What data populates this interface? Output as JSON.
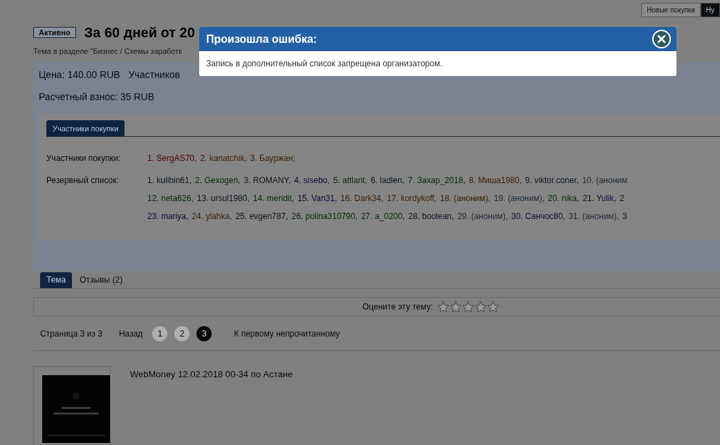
{
  "top_buttons": [
    {
      "label": "Новые покупки",
      "selected": false
    },
    {
      "label": "Ну",
      "selected": true
    }
  ],
  "thread": {
    "status": "Активно",
    "title": "За 60 дней от 20",
    "subtitle": "Тема в разделе \"Бизнес / Схемы заработк"
  },
  "purchase": {
    "price": "Цена: 140.00 RUB",
    "participants_count": "Участников",
    "fee": "Расчетный взнос: 35 RUB",
    "tab": {
      "label": "Участники покупки",
      "selected": true
    },
    "participants_label": "Участники покупки:",
    "participants": [
      {
        "text": "1. SergAS70,",
        "color": "#4a0000"
      },
      {
        "text": "2. kanatchik,",
        "color": "#3e1e00"
      },
      {
        "text": "3. Бауржан;",
        "color": "#3e1e00"
      }
    ],
    "reserve_label": "Резервный список:",
    "reserve_rows": [
      [
        {
          "text": "1. kulibin61,",
          "color": "#0a1420"
        },
        {
          "text": "2. Gexogen,",
          "color": "#002a00"
        },
        {
          "text": "3. ROMANY,",
          "color": "#101418"
        },
        {
          "text": "4. sisebo,",
          "color": "#0a0a3a"
        },
        {
          "text": "5. attlant,",
          "color": "#002a00"
        },
        {
          "text": "6. ladlen,",
          "color": "#0a1420"
        },
        {
          "text": "7. Захар_2018,",
          "color": "#002a00"
        },
        {
          "text": "8. Миша1980,",
          "color": "#3e1e00"
        },
        {
          "text": "9. viktor.coner,",
          "color": "#0a1420"
        },
        {
          "text": "10. (аноним",
          "color": "#1e2a38"
        }
      ],
      [
        {
          "text": "12. neta626,",
          "color": "#002a00"
        },
        {
          "text": "13. ursul1980,",
          "color": "#0a1420"
        },
        {
          "text": "14. meridit,",
          "color": "#002a00"
        },
        {
          "text": "15. Van31,",
          "color": "#0a0a3a"
        },
        {
          "text": "16. Dark34,",
          "color": "#3e1e00"
        },
        {
          "text": "17. kordykoff,",
          "color": "#3e1e00"
        },
        {
          "text": "18. (аноним),",
          "color": "#3e1e00"
        },
        {
          "text": "19. (аноним),",
          "color": "#1e2a38"
        },
        {
          "text": "20. nika,",
          "color": "#002a00"
        },
        {
          "text": "21. Yulik,",
          "color": "#0a0a3a"
        },
        {
          "text": "2",
          "color": "#0a1420"
        }
      ],
      [
        {
          "text": "23. mariya,",
          "color": "#0a0a3a"
        },
        {
          "text": "24. ylahka,",
          "color": "#3e1e00"
        },
        {
          "text": "25. evgen787,",
          "color": "#0a1420"
        },
        {
          "text": "26. polina310790,",
          "color": "#002a00"
        },
        {
          "text": "27. a_0200,",
          "color": "#002a00"
        },
        {
          "text": "28. boolean,",
          "color": "#0a1420"
        },
        {
          "text": "29. (аноним),",
          "color": "#1e2a38"
        },
        {
          "text": "30. Санчос80,",
          "color": "#0a0a3a"
        },
        {
          "text": "31. (аноним),",
          "color": "#1e2a38"
        },
        {
          "text": "3",
          "color": "#0a1420"
        }
      ]
    ]
  },
  "thread_tabs": [
    {
      "label": "Тема",
      "selected": true
    },
    {
      "label": "Отзывы (2)",
      "selected": false
    }
  ],
  "rating": {
    "label": "Оцените эту тему:",
    "stars": 0
  },
  "pagination": {
    "info": "Страница 3 из 3",
    "prev": "Назад",
    "pages": [
      {
        "label": "1",
        "selected": false
      },
      {
        "label": "2",
        "selected": false
      },
      {
        "label": "3",
        "selected": true
      }
    ],
    "unread": "К первому непрочитанному"
  },
  "post": {
    "text": "WebMoney 12.02.2018 00-34 по Астане"
  },
  "dialog": {
    "title": "Произошла ошибка:",
    "message": "Запись в дополнительный список запрещена организатором."
  }
}
